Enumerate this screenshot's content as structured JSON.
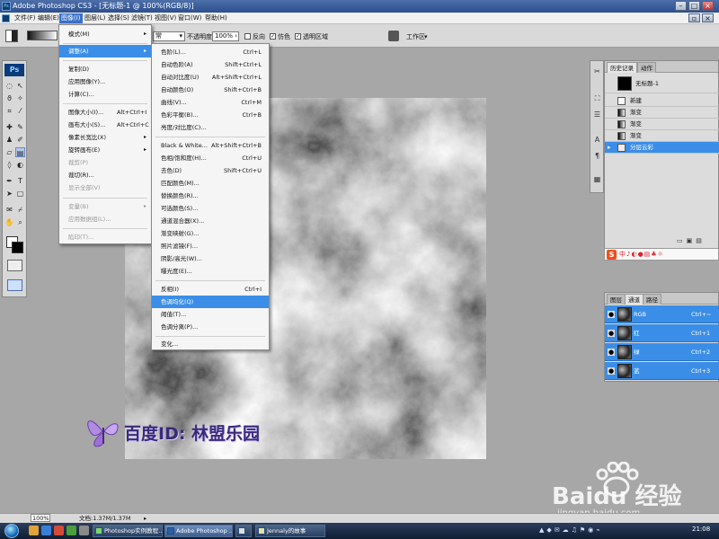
{
  "window": {
    "title": "Adobe Photoshop CS3 - [无标题-1 @ 100%(RGB/8)]"
  },
  "menubar": {
    "items": [
      "文件(F)",
      "编辑(E)",
      "图像(I)",
      "图层(L)",
      "选择(S)",
      "滤镜(T)",
      "视图(V)",
      "窗口(W)",
      "帮助(H)"
    ]
  },
  "optionsbar": {
    "mode_value": "常",
    "opacity_label": "不透明度:",
    "opacity_value": "100%",
    "reverse_label": "反向",
    "dither_label": "仿色",
    "transparency_label": "透明区域",
    "workspace_label": "工作区"
  },
  "image_menu": {
    "items": [
      {
        "label": "模式(M)",
        "submenu": true
      },
      {
        "label": "调整(A)",
        "submenu": true,
        "highlight": true
      },
      {
        "label": "复制(D)"
      },
      {
        "label": "应用图像(Y)..."
      },
      {
        "label": "计算(C)..."
      },
      {
        "label": "图像大小(I)...",
        "shortcut": "Alt+Ctrl+I"
      },
      {
        "label": "画布大小(S)...",
        "shortcut": "Alt+Ctrl+C"
      },
      {
        "label": "像素长宽比(X)",
        "submenu": true
      },
      {
        "label": "旋转画布(E)",
        "submenu": true
      },
      {
        "label": "裁剪(P)",
        "disabled": true
      },
      {
        "label": "裁切(R)..."
      },
      {
        "label": "显示全部(V)",
        "disabled": true
      },
      {
        "label": "变量(B)",
        "submenu": true,
        "disabled": true
      },
      {
        "label": "应用数据组(L)...",
        "disabled": true
      },
      {
        "label": "陷印(T)...",
        "disabled": true
      }
    ]
  },
  "adjust_menu": {
    "items": [
      {
        "label": "色阶(L)...",
        "shortcut": "Ctrl+L"
      },
      {
        "label": "自动色阶(A)",
        "shortcut": "Shift+Ctrl+L"
      },
      {
        "label": "自动对比度(U)",
        "shortcut": "Alt+Shift+Ctrl+L"
      },
      {
        "label": "自动颜色(O)",
        "shortcut": "Shift+Ctrl+B"
      },
      {
        "label": "曲线(V)...",
        "shortcut": "Ctrl+M"
      },
      {
        "label": "色彩平衡(B)...",
        "shortcut": "Ctrl+B"
      },
      {
        "label": "亮度/对比度(C)..."
      },
      {
        "label": "Black & White...",
        "shortcut": "Alt+Shift+Ctrl+B"
      },
      {
        "label": "色相/饱和度(H)...",
        "shortcut": "Ctrl+U"
      },
      {
        "label": "去色(D)",
        "shortcut": "Shift+Ctrl+U"
      },
      {
        "label": "匹配颜色(M)..."
      },
      {
        "label": "替换颜色(R)..."
      },
      {
        "label": "可选颜色(S)..."
      },
      {
        "label": "通道混合器(X)..."
      },
      {
        "label": "渐变映射(G)..."
      },
      {
        "label": "照片滤镜(F)..."
      },
      {
        "label": "阴影/高光(W)..."
      },
      {
        "label": "曝光度(E)..."
      },
      {
        "label": "反相(I)",
        "shortcut": "Ctrl+I"
      },
      {
        "label": "色调均化(Q)",
        "highlight": true
      },
      {
        "label": "阈值(T)..."
      },
      {
        "label": "色调分离(P)..."
      },
      {
        "label": "变化..."
      }
    ]
  },
  "history_panel": {
    "tabs": [
      "历史记录",
      "动作"
    ],
    "snapshot": "无标题-1",
    "rows": [
      "新建",
      "渐变",
      "渐变",
      "渐变",
      "分层云彩"
    ]
  },
  "channels_panel": {
    "tabs": [
      "图层",
      "通道",
      "路径"
    ],
    "rows": [
      {
        "name": "RGB",
        "shortcut": "Ctrl+~"
      },
      {
        "name": "红",
        "shortcut": "Ctrl+1"
      },
      {
        "name": "绿",
        "shortcut": "Ctrl+2"
      },
      {
        "name": "蓝",
        "shortcut": "Ctrl+3"
      }
    ]
  },
  "statusbar": {
    "zoom": "100%",
    "doc_info": "文档:1.37M/1.37M"
  },
  "taskbar": {
    "buttons": [
      "Photoshop实例教程...",
      "Adobe Photoshop ...",
      "Jennaly的故事"
    ],
    "clock": "21:08"
  },
  "watermark": {
    "text": "百度ID: 林盟乐园"
  },
  "baidu_logo": {
    "text": "Baidu 经验",
    "url_text": "jingyan.baidu.com"
  },
  "colors": {
    "highlight": "#3b8ee8",
    "menu_active": "#3a6fc9",
    "watermark_text": "#3a2a7a"
  }
}
